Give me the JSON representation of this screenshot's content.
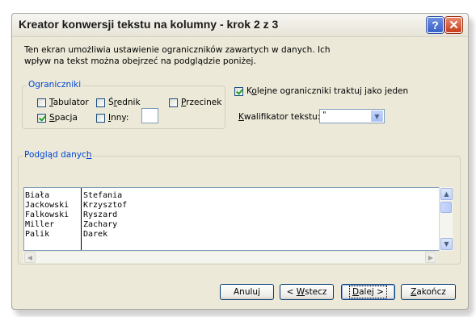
{
  "window": {
    "title": "Kreator konwersji tekstu na kolumny - krok 2 z 3",
    "help_glyph": "?",
    "close_glyph": "✕"
  },
  "description": {
    "line1": "Ten ekran umożliwia ustawienie ograniczników zawartych w danych. Ich",
    "line2": "wpływ na tekst można obejrzeć na podglądzie poniżej."
  },
  "delimiters": {
    "legend": "Ograniczniki",
    "tab": {
      "pre": "",
      "ul": "T",
      "post": "abulator",
      "checked": false
    },
    "semicolon": {
      "pre": "Ś",
      "ul": "r",
      "post": "ednik",
      "checked": false
    },
    "comma": {
      "pre": "",
      "ul": "P",
      "post": "rzecinek",
      "checked": false
    },
    "space": {
      "pre": "",
      "ul": "S",
      "post": "pacja",
      "checked": true
    },
    "other": {
      "pre": "",
      "ul": "I",
      "post": "nny:",
      "checked": false,
      "value": ""
    }
  },
  "consecutive": {
    "pre": "K",
    "ul": "o",
    "post": "lejne ograniczniki traktuj jako jeden",
    "checked": true
  },
  "qualifier": {
    "pre": "",
    "ul": "K",
    "post": "walifikator tekstu:",
    "value": "\""
  },
  "preview": {
    "legend_pre": "Podgląd danyc",
    "legend_ul": "h",
    "rows": [
      {
        "c1": "Biała",
        "c2": "Stefania"
      },
      {
        "c1": "Jackowski",
        "c2": "Krzysztof"
      },
      {
        "c1": "Falkowski",
        "c2": "Ryszard"
      },
      {
        "c1": "Miller",
        "c2": "Zachary"
      },
      {
        "c1": "Palik",
        "c2": "Darek"
      }
    ]
  },
  "buttons": {
    "cancel": "Anuluj",
    "back": {
      "pre": "< ",
      "ul": "W",
      "post": "stecz"
    },
    "next": {
      "pre": "",
      "ul": "D",
      "post": "alej >"
    },
    "finish": {
      "pre": "",
      "ul": "Z",
      "post": "akończ"
    }
  }
}
